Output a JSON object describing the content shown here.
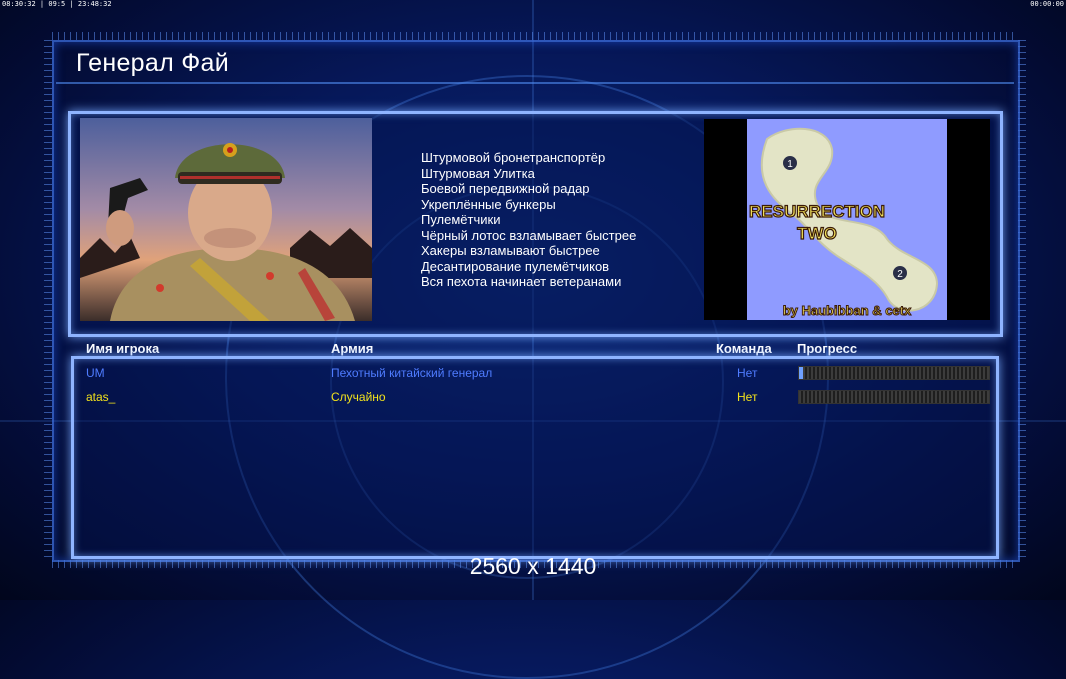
{
  "overlay": {
    "top_left": "08:30:32 | 09:5 | 23:48:32",
    "top_right": "00:00:00"
  },
  "window": {
    "title": "Генерал Фай"
  },
  "general": {
    "portrait_icon": "general-portrait",
    "perks": [
      "Штурмовой бронетранспортёр",
      "Штурмовая Улитка",
      "Боевой передвижной радар",
      "Укреплённые бункеры",
      "Пулемётчики",
      "Чёрный лотос взламывает быстрее",
      "Хакеры взламывают быстрее",
      "Десантирование пулемётчиков",
      "Вся пехота начинает ветеранами"
    ]
  },
  "map": {
    "name_line1": "RESURRECTION",
    "name_line2": "TWO",
    "credit": "by Haubibban & cetx",
    "spawn1": "1",
    "spawn2": "2"
  },
  "players_table": {
    "headers": {
      "player": "Имя игрока",
      "army": "Армия",
      "team": "Команда",
      "progress": "Прогресс"
    },
    "rows": [
      {
        "name": "UM",
        "army": "Пехотный китайский генерал",
        "team": "Нет",
        "progress": 0.02,
        "color": "#4f7cff"
      },
      {
        "name": "atas_",
        "army": "Случайно",
        "team": "Нет",
        "progress": 0.0,
        "color": "#f2e21c"
      }
    ]
  },
  "footer": {
    "resolution": "2560 x 1440"
  },
  "colors": {
    "accent": "#8fb4ff",
    "background": "#06185a"
  }
}
